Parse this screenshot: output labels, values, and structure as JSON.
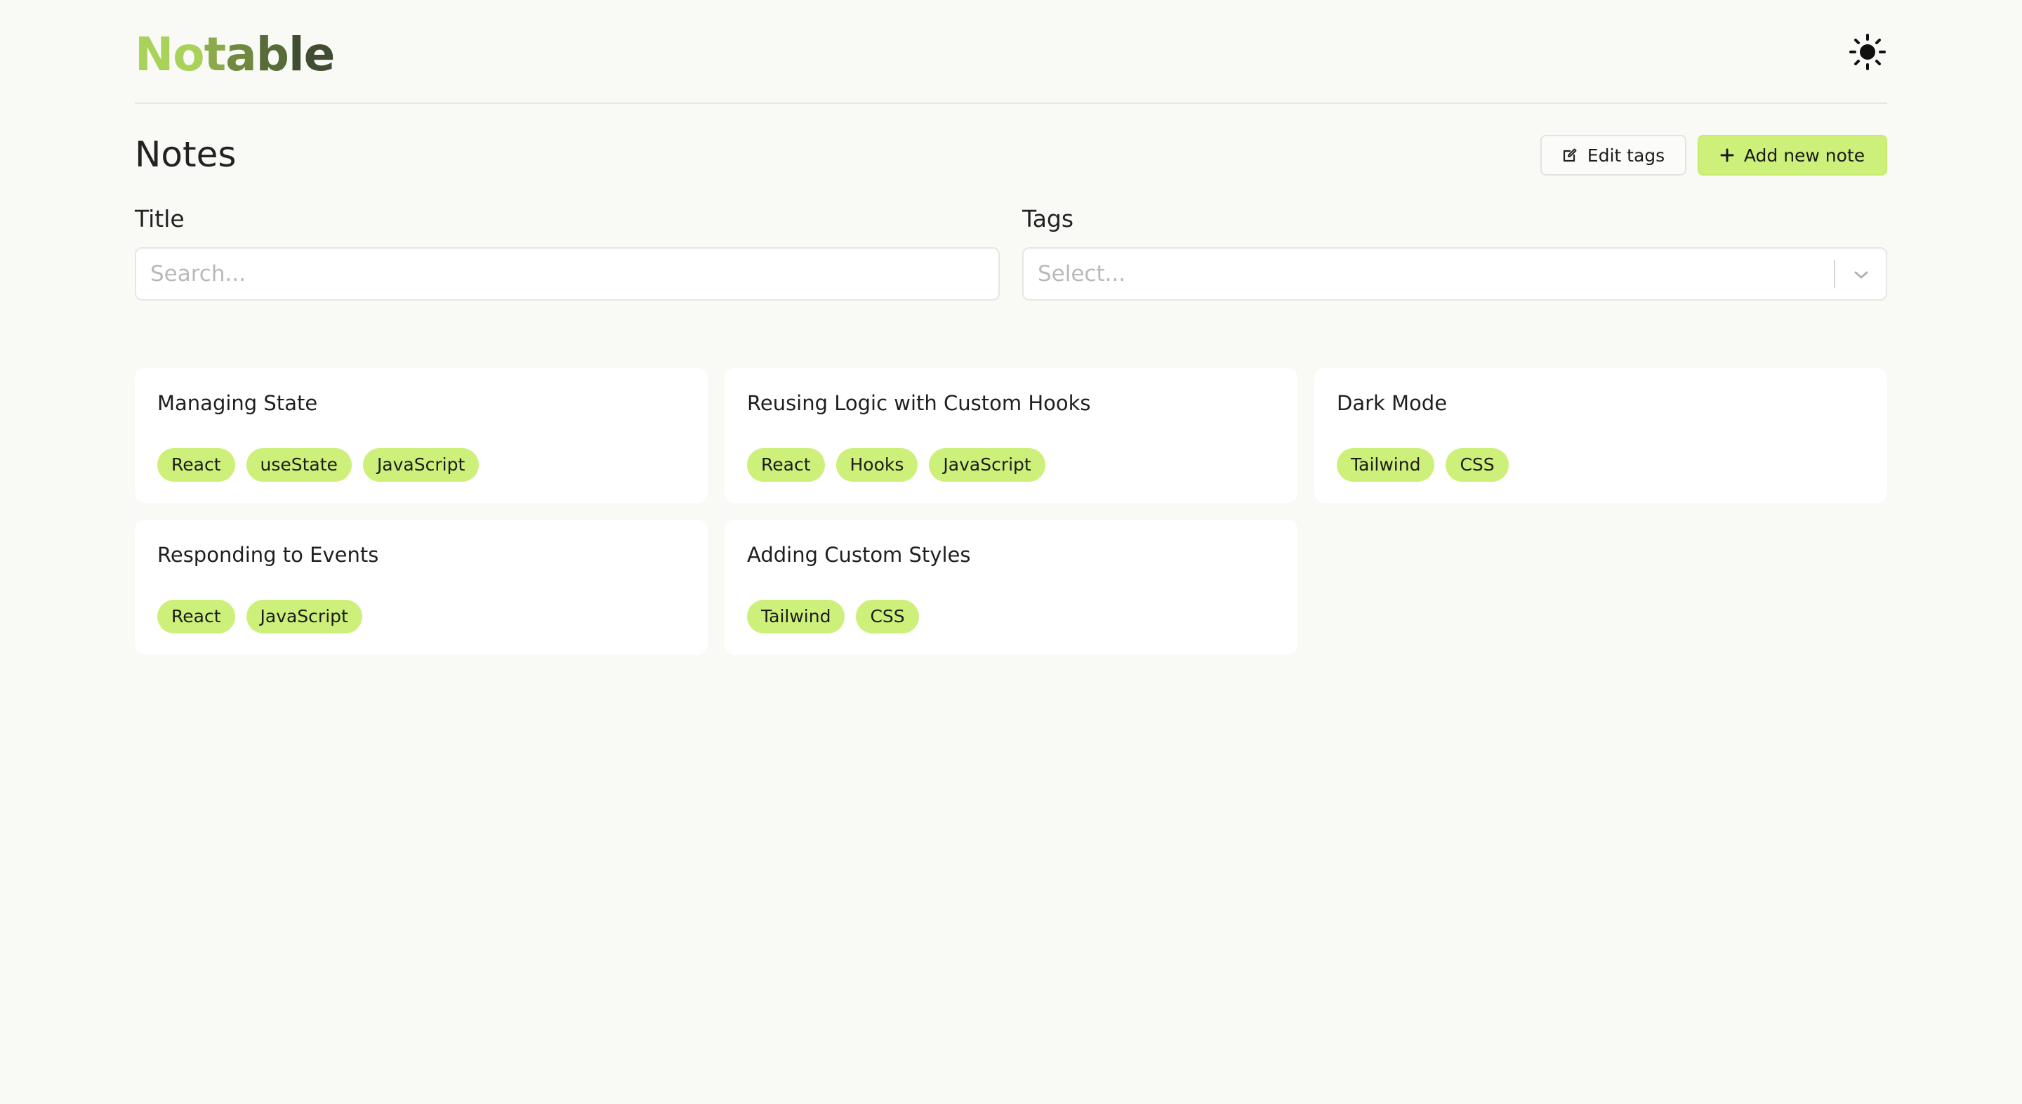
{
  "app": {
    "logo_parts": [
      {
        "text": "No",
        "color": "#a9d25a"
      },
      {
        "text": "t",
        "color": "#8bab4b"
      },
      {
        "text": "a",
        "color": "#6f8a40"
      },
      {
        "text": "b",
        "color": "#576c39"
      },
      {
        "text": "le",
        "color": "#404d31"
      }
    ],
    "theme_icon": "sun-icon"
  },
  "page": {
    "title": "Notes",
    "edit_tags_label": "Edit tags",
    "add_note_label": "Add new note",
    "edit_icon": "edit-icon",
    "add_icon": "plus-icon"
  },
  "filters": {
    "title_label": "Title",
    "title_placeholder": "Search...",
    "title_value": "",
    "tags_label": "Tags",
    "tags_placeholder": "Select...",
    "tags_icon": "chevron-down-icon"
  },
  "colors": {
    "accent": "#cdf07a",
    "background": "#f9f9f6",
    "card": "#ffffff"
  },
  "notes": [
    {
      "title": "Managing State",
      "tags": [
        "React",
        "useState",
        "JavaScript"
      ]
    },
    {
      "title": "Reusing Logic with Custom Hooks",
      "tags": [
        "React",
        "Hooks",
        "JavaScript"
      ]
    },
    {
      "title": "Dark Mode",
      "tags": [
        "Tailwind",
        "CSS"
      ]
    },
    {
      "title": "Responding to Events",
      "tags": [
        "React",
        "JavaScript"
      ]
    },
    {
      "title": "Adding Custom Styles",
      "tags": [
        "Tailwind",
        "CSS"
      ]
    }
  ]
}
